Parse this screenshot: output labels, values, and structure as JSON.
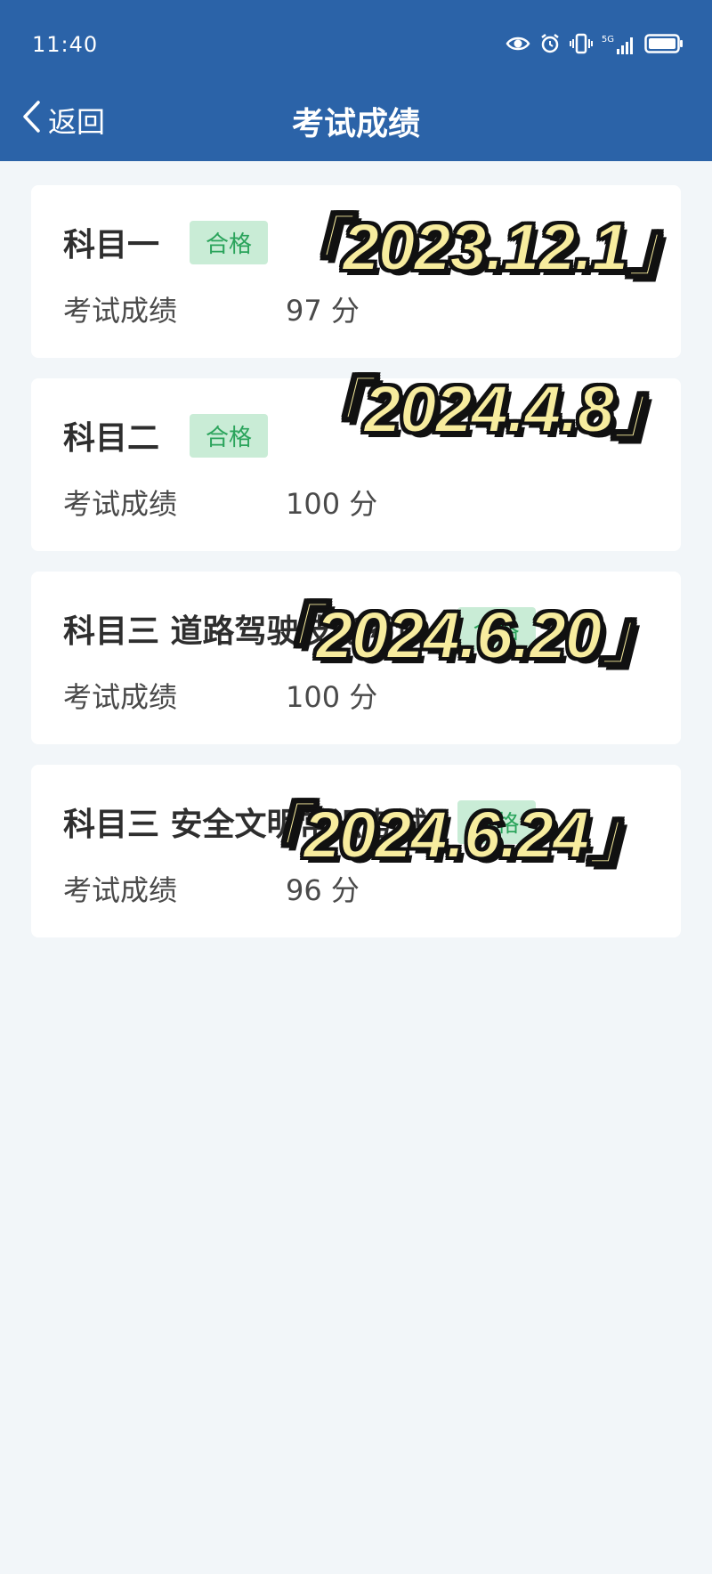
{
  "status_bar": {
    "time": "11:40",
    "network": "5G",
    "icons": [
      "eye-icon",
      "alarm-icon",
      "vibrate-icon",
      "signal-icon",
      "battery-icon"
    ]
  },
  "nav": {
    "back_label": "返回",
    "title": "考试成绩"
  },
  "exams": [
    {
      "subject": "科目一",
      "status": "合格",
      "score_label": "考试成绩",
      "score": "97 分",
      "date_stamp": "「2023.12.1」"
    },
    {
      "subject": "科目二",
      "status": "合格",
      "score_label": "考试成绩",
      "score": "100 分",
      "date_stamp": "「2024.4.8」"
    },
    {
      "subject": "科目三 道路驾驶技能考试",
      "status": "合格",
      "score_label": "考试成绩",
      "score": "100 分",
      "date_stamp": "「2024.6.20」"
    },
    {
      "subject": "科目三 安全文明常识考试",
      "status": "合格",
      "score_label": "考试成绩",
      "score": "96 分",
      "date_stamp": "「2024.6.24」"
    }
  ],
  "colors": {
    "header_bg": "#2b63a8",
    "page_bg": "#f2f6f9",
    "badge_bg": "#c9ecd6",
    "badge_text": "#2ba45c",
    "stamp_fill": "#f7ec9e"
  }
}
